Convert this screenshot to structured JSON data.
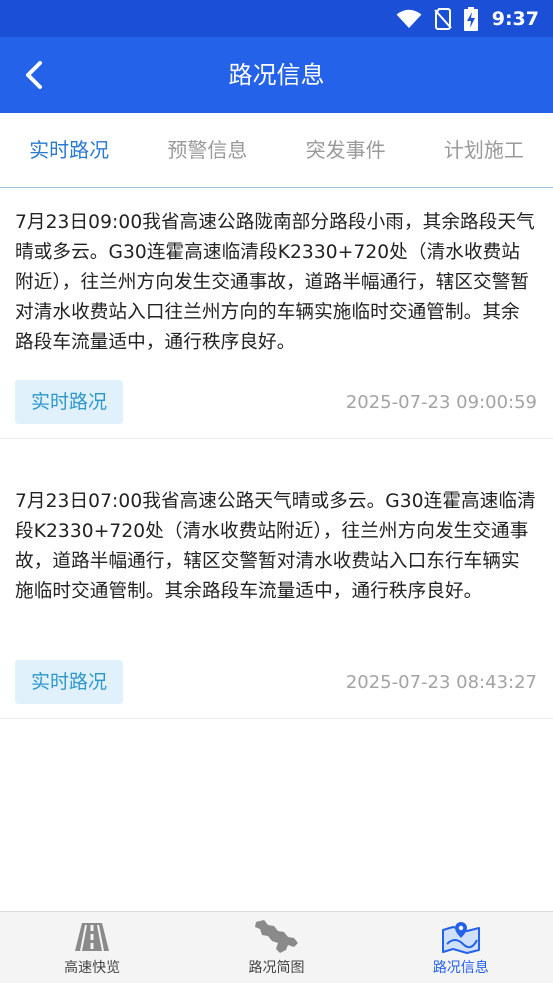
{
  "status_bar": {
    "time": "9:37"
  },
  "header": {
    "title": "路况信息"
  },
  "tabs": [
    {
      "label": "实时路况",
      "active": true
    },
    {
      "label": "预警信息",
      "active": false
    },
    {
      "label": "突发事件",
      "active": false
    },
    {
      "label": "计划施工",
      "active": false
    }
  ],
  "items": [
    {
      "text": "7月23日09:00我省高速公路陇南部分路段小雨，其余路段天气晴或多云。G30连霍高速临清段K2330+720处（清水收费站附近），往兰州方向发生交通事故，道路半幅通行，辖区交警暂对清水收费站入口往兰州方向的车辆实施临时交通管制。其余路段车流量适中，通行秩序良好。",
      "tag": "实时路况",
      "timestamp": "2025-07-23 09:00:59"
    },
    {
      "text": "7月23日07:00我省高速公路天气晴或多云。G30连霍高速临清段K2330+720处（清水收费站附近），往兰州方向发生交通事故，道路半幅通行，辖区交警暂对清水收费站入口东行车辆实施临时交通管制。其余路段车流量适中，通行秩序良好。",
      "tag": "实时路况",
      "timestamp": "2025-07-23 08:43:27"
    }
  ],
  "bottom_nav": [
    {
      "label": "高速快览",
      "icon": "highway-icon",
      "active": false
    },
    {
      "label": "路况简图",
      "icon": "province-map-icon",
      "active": false
    },
    {
      "label": "路况信息",
      "icon": "road-info-map-icon",
      "active": true
    }
  ],
  "colors": {
    "header": "#2462ea",
    "status_bar": "#1a4fd6",
    "active_tab": "#2a7bd0",
    "tag_bg": "#e1f1fb",
    "tag_text": "#2e98cc"
  }
}
